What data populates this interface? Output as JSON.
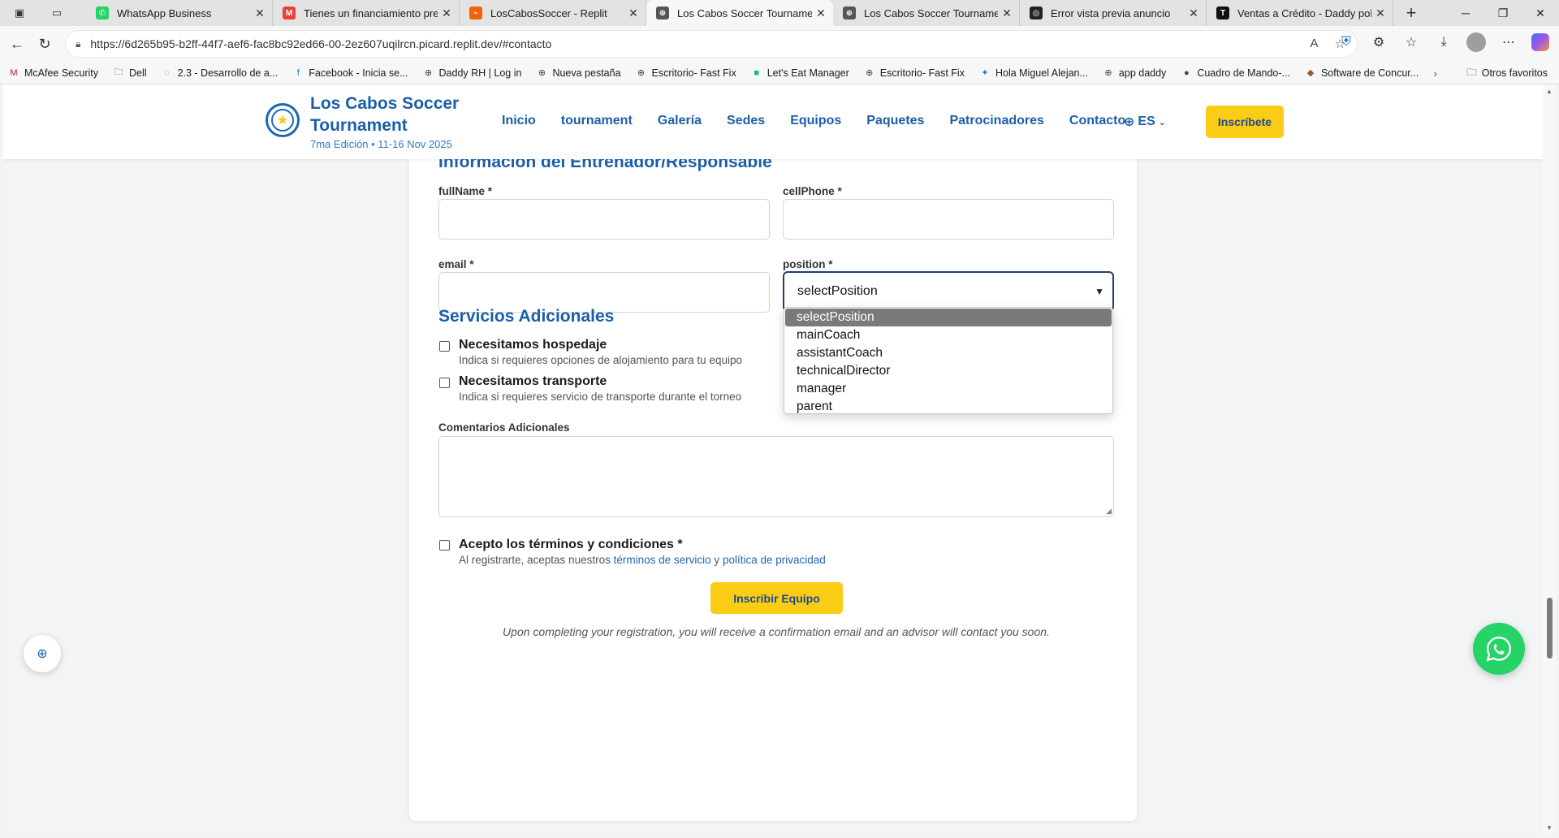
{
  "browser": {
    "tabs": [
      {
        "title": "WhatsApp Business",
        "favicon": "whatsapp-icon",
        "color": "#25d366",
        "active": false
      },
      {
        "title": "Tienes un financiamiento pre-ap",
        "favicon": "gmail-icon",
        "color": "#ea4335",
        "active": false
      },
      {
        "title": "LosCabosSoccer - Replit",
        "favicon": "replit-icon",
        "color": "#f26207",
        "active": false
      },
      {
        "title": "Los Cabos Soccer Tournament -",
        "favicon": "globe-icon",
        "color": "#555555",
        "active": true
      },
      {
        "title": "Los Cabos Soccer Tournament -",
        "favicon": "globe-icon",
        "color": "#555555",
        "active": false
      },
      {
        "title": "Error vista previa anuncio",
        "favicon": "openai-icon",
        "color": "#222222",
        "active": false
      },
      {
        "title": "Ventas a Crédito - Daddy pollo",
        "favicon": "notion-icon",
        "color": "#111111",
        "active": false
      }
    ],
    "url": "https://6d265b95-b2ff-44f7-aef6-fac8bc92ed66-00-2ez607uqilrcn.picard.replit.dev/#contacto",
    "bookmarks": [
      {
        "label": "McAfee Security",
        "icon": "mcafee-icon"
      },
      {
        "label": "Dell",
        "icon": "folder-icon"
      },
      {
        "label": "2.3 - Desarrollo de a...",
        "icon": "loading-icon"
      },
      {
        "label": "Facebook - Inicia se...",
        "icon": "facebook-icon"
      },
      {
        "label": "Daddy RH | Log in",
        "icon": "globe-icon"
      },
      {
        "label": "Nueva pestaña",
        "icon": "globe-icon"
      },
      {
        "label": "Escritorio- Fast Fix",
        "icon": "globe-icon"
      },
      {
        "label": "Let's Eat Manager",
        "icon": "app-icon"
      },
      {
        "label": "Escritorio- Fast Fix",
        "icon": "globe-icon"
      },
      {
        "label": "Hola Miguel Alejan...",
        "icon": "jira-icon"
      },
      {
        "label": "app daddy",
        "icon": "globe-icon"
      },
      {
        "label": "Cuadro de Mando-...",
        "icon": "dashboard-icon"
      },
      {
        "label": "Software de Concur...",
        "icon": "software-icon"
      }
    ],
    "other_favorites": "Otros favoritos"
  },
  "site": {
    "brand_name": "Los Cabos Soccer Tournament",
    "edition": "7ma Edición • 11-16 Nov 2025",
    "nav": [
      "Inicio",
      "tournament",
      "Galería",
      "Sedes",
      "Equipos",
      "Paquetes",
      "Patrocinadores",
      "Contacto"
    ],
    "language": "ES",
    "cta": "Inscríbete"
  },
  "form": {
    "coach_section_title": "Información del Entrenador/Responsable",
    "labels": {
      "fullName": "fullName *",
      "cellPhone": "cellPhone *",
      "email": "email *",
      "position": "position *"
    },
    "position": {
      "selected": "selectPosition",
      "options": [
        "selectPosition",
        "mainCoach",
        "assistantCoach",
        "technicalDirector",
        "manager",
        "parent"
      ]
    },
    "services_title": "Servicios Adicionales",
    "lodging_title": "Necesitamos hospedaje",
    "lodging_desc": "Indica si requieres opciones de alojamiento para tu equipo",
    "transport_title": "Necesitamos transporte",
    "transport_desc": "Indica si requieres servicio de transporte durante el torneo",
    "comments_label": "Comentarios Adicionales",
    "terms_title": "Acepto los términos y condiciones *",
    "terms_prefix": "Al registrarte, aceptas nuestros",
    "terms_link": "términos de servicio",
    "terms_and": "y",
    "privacy_link": "política de privacidad",
    "submit": "Inscribir Equipo",
    "note": "Upon completing your registration, you will receive a confirmation email and an advisor will contact you soon."
  },
  "colors": {
    "brand_blue": "#1b5fa8",
    "cta_yellow": "#facc15",
    "whatsapp_green": "#25d366"
  }
}
